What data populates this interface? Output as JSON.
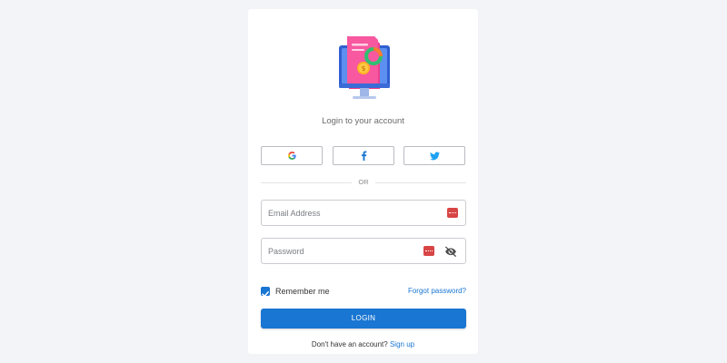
{
  "header": {
    "subtitle": "Login to your account"
  },
  "social": {
    "google_icon": "google-icon",
    "facebook_icon": "facebook-icon",
    "twitter_icon": "twitter-icon"
  },
  "divider": {
    "text": "OR"
  },
  "email": {
    "placeholder": "Email Address",
    "value": ""
  },
  "password": {
    "placeholder": "Password",
    "value": ""
  },
  "remember": {
    "label": "Remember me",
    "checked": true
  },
  "forgot": {
    "label": "Forgot password?"
  },
  "login": {
    "label": "LOGIN"
  },
  "signup": {
    "prompt": "Don't have an account?",
    "link": "Sign up"
  },
  "colors": {
    "primary": "#1976d2",
    "background": "#f3f4f7",
    "card": "#ffffff",
    "google_red": "#e53935",
    "password_badge": "#d84545"
  }
}
